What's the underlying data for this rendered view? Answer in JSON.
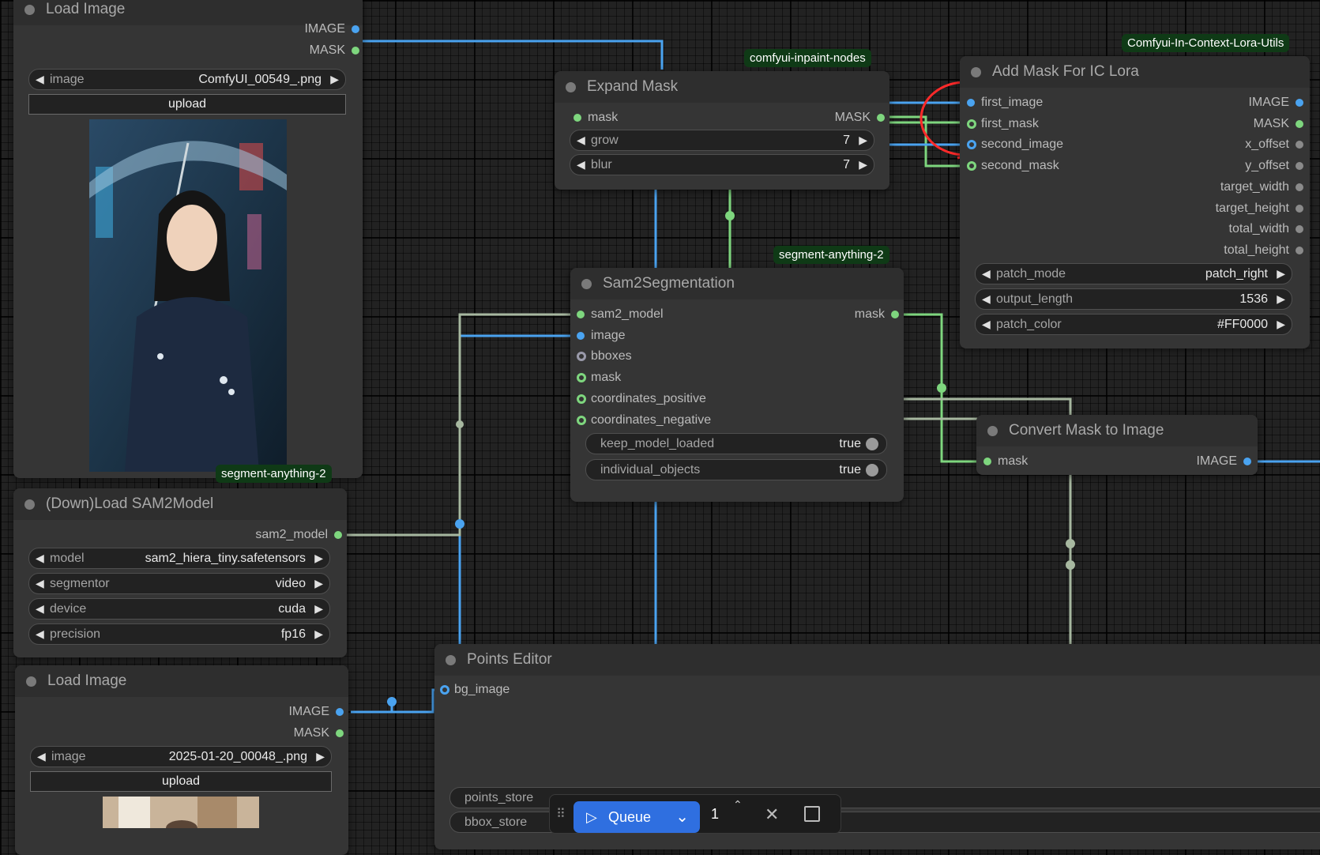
{
  "nodes": {
    "load_image_1": {
      "title": "Load Image",
      "outputs": {
        "image": "IMAGE",
        "mask": "MASK"
      },
      "widgets": {
        "image": {
          "label": "image",
          "value": "ComfyUI_00549_.png"
        }
      },
      "upload_label": "upload"
    },
    "load_sam2": {
      "title": "(Down)Load SAM2Model",
      "badge": "segment-anything-2",
      "outputs": {
        "sam2_model": "sam2_model"
      },
      "widgets": {
        "model": {
          "label": "model",
          "value": "sam2_hiera_tiny.safetensors"
        },
        "segmentor": {
          "label": "segmentor",
          "value": "video"
        },
        "device": {
          "label": "device",
          "value": "cuda"
        },
        "precision": {
          "label": "precision",
          "value": "fp16"
        }
      }
    },
    "load_image_2": {
      "title": "Load Image",
      "outputs": {
        "image": "IMAGE",
        "mask": "MASK"
      },
      "widgets": {
        "image": {
          "label": "image",
          "value": "2025-01-20_00048_.png"
        }
      },
      "upload_label": "upload"
    },
    "expand_mask": {
      "title": "Expand Mask",
      "badge": "comfyui-inpaint-nodes",
      "inputs": {
        "mask": "mask"
      },
      "outputs": {
        "mask": "MASK"
      },
      "widgets": {
        "grow": {
          "label": "grow",
          "value": "7"
        },
        "blur": {
          "label": "blur",
          "value": "7"
        }
      }
    },
    "sam2seg": {
      "title": "Sam2Segmentation",
      "badge": "segment-anything-2",
      "inputs": [
        "sam2_model",
        "image",
        "bboxes",
        "mask",
        "coordinates_positive",
        "coordinates_negative"
      ],
      "outputs": {
        "mask": "mask"
      },
      "toggles": {
        "keep_model_loaded": {
          "label": "keep_model_loaded",
          "value": "true"
        },
        "individual_objects": {
          "label": "individual_objects",
          "value": "true"
        }
      }
    },
    "add_mask": {
      "title": "Add Mask For IC Lora",
      "badge": "Comfyui-In-Context-Lora-Utils",
      "inputs": [
        "first_image",
        "first_mask",
        "second_image",
        "second_mask"
      ],
      "outputs": [
        "IMAGE",
        "MASK",
        "x_offset",
        "y_offset",
        "target_width",
        "target_height",
        "total_width",
        "total_height"
      ],
      "widgets": {
        "patch_mode": {
          "label": "patch_mode",
          "value": "patch_right"
        },
        "output_length": {
          "label": "output_length",
          "value": "1536"
        },
        "patch_color": {
          "label": "patch_color",
          "value": "#FF0000"
        }
      }
    },
    "convert_mask": {
      "title": "Convert Mask to Image",
      "inputs": {
        "mask": "mask"
      },
      "outputs": {
        "image": "IMAGE"
      }
    },
    "points_editor": {
      "title": "Points Editor",
      "inputs": {
        "bg_image": "bg_image"
      },
      "fields": {
        "points_store": "points_store",
        "bbox_store": "bbox_store"
      }
    }
  },
  "queue_bar": {
    "queue_label": "Queue",
    "batch_count": "1"
  },
  "colors": {
    "image_wire": "#4aa3f0",
    "mask_wire": "#7ed67e",
    "model_wire": "#a7b8a0",
    "badge_bg": "#0f3a16",
    "annotation": "#ff2a2a"
  },
  "icons": [
    "play-icon",
    "chevron-down-icon",
    "chevron-up-icon",
    "close-icon",
    "stop-icon",
    "drag-handle-icon",
    "arrow-left-icon",
    "arrow-right-icon"
  ]
}
